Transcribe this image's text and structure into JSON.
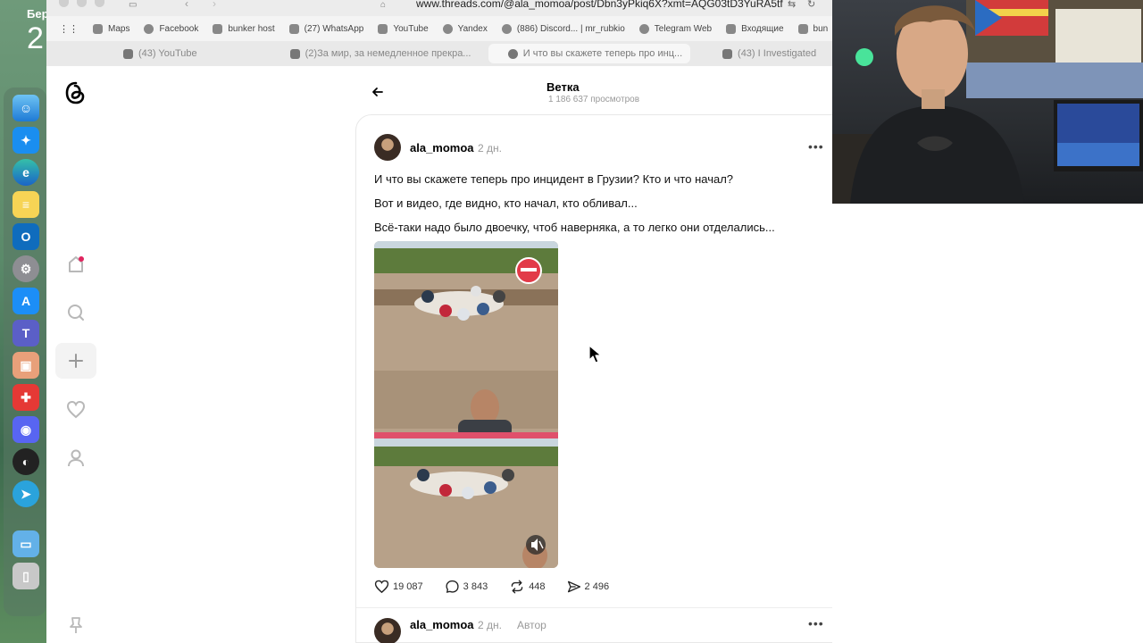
{
  "desktop": {
    "label": "Бер",
    "number": "2"
  },
  "browser": {
    "url": "www.threads.com/@ala_momoa/post/Dbn3yPkiq6X?xmt=AQG03tD3YuRA5tf",
    "bookmarks": [
      "Maps",
      "Facebook",
      "bunker host",
      "(27) WhatsApp",
      "YouTube",
      "Yandex",
      "(886) Discord... | mr_rubkio",
      "Telegram Web",
      "Входящие",
      "bun"
    ],
    "tabs": [
      "(43) YouTube",
      "(2)За мир, за немедленное прекра...",
      "И что вы скажете теперь про инц...",
      "(43) I Investigated"
    ]
  },
  "thread": {
    "title": "Ветка",
    "views": "1 186 637 просмотров"
  },
  "post": {
    "username": "ala_momoa",
    "time": "2 дн.",
    "lines": [
      "И что вы скажете теперь про инцидент в Грузии? Кто и что начал?",
      "Вот и видео, где видно, кто начал, кто обливал...",
      "Всё-таки надо было двоечку, чтоб наверняка, а то легко они отделались..."
    ],
    "likes": "19 087",
    "comments": "3 843",
    "reposts": "448",
    "shares": "2 496"
  },
  "reply": {
    "username": "ala_momoa",
    "time": "2 дн.",
    "badge": "Автор"
  },
  "icons": {
    "threads_logo": "threads-logo-icon",
    "sidebar": [
      "home-icon",
      "search-icon",
      "create-icon",
      "activity-icon",
      "profile-icon",
      "pin-icon"
    ]
  }
}
